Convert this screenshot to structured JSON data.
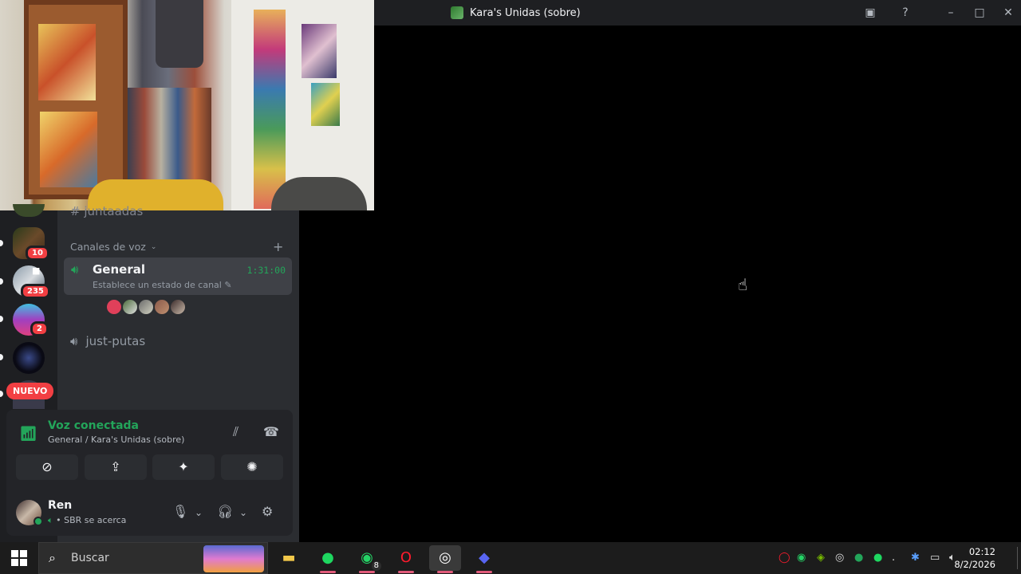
{
  "window": {
    "title": "Kara's Unidas (sobre)"
  },
  "sidebar": {
    "servers": [
      {
        "name": "server-1",
        "badge": "10",
        "color": "#5a4a2a"
      },
      {
        "name": "server-2",
        "badge": "235",
        "color": "#6a7a8a"
      },
      {
        "name": "server-3",
        "badge": "2",
        "color": "#a040c0"
      },
      {
        "name": "server-4",
        "badge": "",
        "color": "#101018"
      }
    ],
    "new_label": "NUEVO"
  },
  "channels": {
    "faded_channel": "juntaadas",
    "voice_category": "Canales de voz",
    "voice_channels": [
      {
        "name": "General",
        "timer": "1:31:00",
        "status": "Establece un estado de canal",
        "active": true
      },
      {
        "name": "just-putas",
        "active": false
      }
    ]
  },
  "voice_panel": {
    "title": "Voz conectada",
    "subtitle": "General / Kara's Unidas (sobre)"
  },
  "user_panel": {
    "name": "Ren",
    "status": "• SBR se acerca"
  },
  "taskbar": {
    "search_placeholder": "Buscar",
    "whatsapp_count": "8",
    "time": "02:12",
    "date": "8/2/2026"
  },
  "colors": {
    "accent_green": "#23a55a",
    "badge_red": "#f23f43",
    "panel_bg": "#2b2d31"
  }
}
